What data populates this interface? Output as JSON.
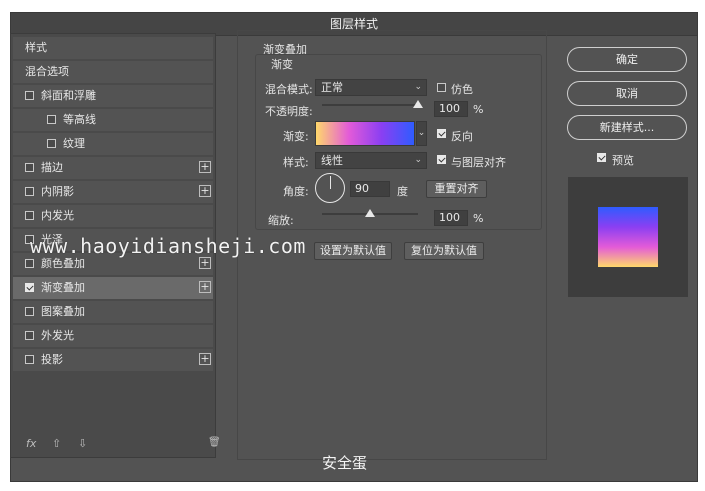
{
  "window": {
    "title": "图层样式"
  },
  "left_panel": {
    "items": [
      {
        "label": "样式",
        "checkbox": false,
        "checked": false,
        "plus": false,
        "selected": false
      },
      {
        "label": "混合选项",
        "checkbox": false,
        "checked": false,
        "plus": false,
        "selected": false
      },
      {
        "label": "斜面和浮雕",
        "checkbox": true,
        "checked": false,
        "plus": false,
        "selected": false
      },
      {
        "label": "等高线",
        "checkbox": true,
        "checked": false,
        "plus": false,
        "selected": false
      },
      {
        "label": "纹理",
        "checkbox": true,
        "checked": false,
        "plus": false,
        "selected": false
      },
      {
        "label": "描边",
        "checkbox": true,
        "checked": false,
        "plus": true,
        "selected": false
      },
      {
        "label": "内阴影",
        "checkbox": true,
        "checked": false,
        "plus": true,
        "selected": false
      },
      {
        "label": "内发光",
        "checkbox": true,
        "checked": false,
        "plus": false,
        "selected": false
      },
      {
        "label": "光泽",
        "checkbox": true,
        "checked": false,
        "plus": false,
        "selected": false
      },
      {
        "label": "颜色叠加",
        "checkbox": true,
        "checked": false,
        "plus": true,
        "selected": false
      },
      {
        "label": "渐变叠加",
        "checkbox": true,
        "checked": true,
        "plus": true,
        "selected": true
      },
      {
        "label": "图案叠加",
        "checkbox": true,
        "checked": false,
        "plus": false,
        "selected": false
      },
      {
        "label": "外发光",
        "checkbox": true,
        "checked": false,
        "plus": false,
        "selected": false
      },
      {
        "label": "投影",
        "checkbox": true,
        "checked": false,
        "plus": true,
        "selected": false
      }
    ],
    "footer": {
      "fx": "fx",
      "up": "⇧",
      "down": "⇩",
      "trash": "🗑"
    }
  },
  "gradient_overlay": {
    "section_title": "渐变叠加",
    "group_title": "渐变",
    "blend_mode_label": "混合模式:",
    "blend_mode_value": "正常",
    "dither_label": "仿色",
    "dither_checked": false,
    "opacity_label": "不透明度:",
    "opacity_value": "100",
    "opacity_unit": "%",
    "opacity_level": 1.0,
    "gradient_label": "渐变:",
    "reverse_label": "反向",
    "reverse_checked": true,
    "style_label": "样式:",
    "style_value": "线性",
    "align_label": "与图层对齐",
    "align_checked": true,
    "angle_label": "角度:",
    "angle_value": "90",
    "angle_unit": "度",
    "reset_align_button": "重置对齐",
    "scale_label": "缩放:",
    "scale_value": "100",
    "scale_unit": "%",
    "scale_level": 0.5,
    "set_default_button": "设置为默认值",
    "reset_default_button": "复位为默认值"
  },
  "right_panel": {
    "ok_button": "确定",
    "cancel_button": "取消",
    "new_style_button": "新建样式...",
    "preview_label": "预览",
    "preview_checked": true
  },
  "overlay": {
    "watermark": "www.haoyidiansheji.com",
    "caption": "安全蛋"
  },
  "colors": {
    "gradient_stops": [
      "#ffd86b",
      "#e35bd8",
      "#8b3ff2",
      "#2f5cff"
    ]
  }
}
